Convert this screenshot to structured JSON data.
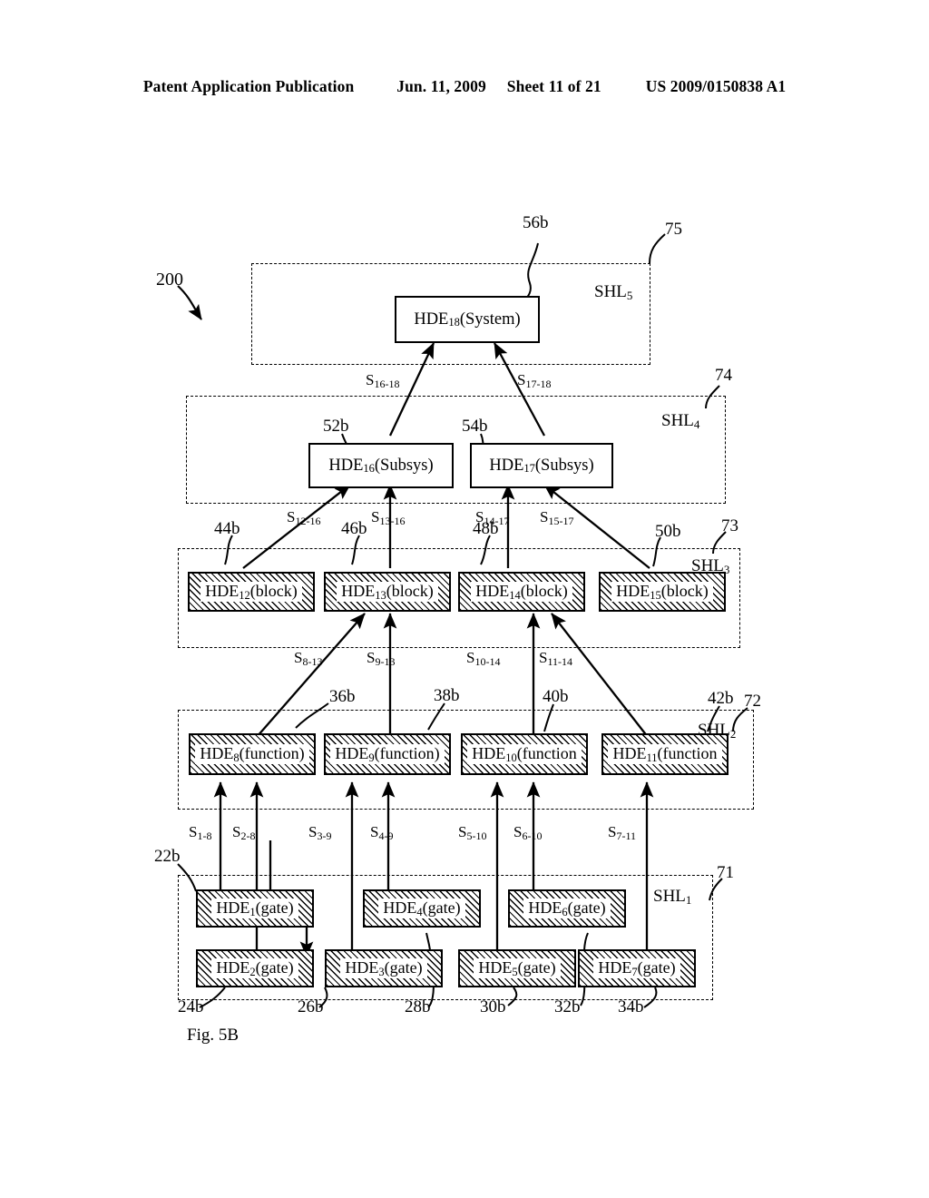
{
  "header": {
    "publication": "Patent Application Publication",
    "date": "Jun. 11, 2009",
    "sheet": "Sheet 11 of 21",
    "patent_number": "US 2009/0150838 A1"
  },
  "figure": {
    "caption": "Fig. 5B",
    "system_ref": "200"
  },
  "layers": [
    {
      "tag": "SHL",
      "sub": "5",
      "ref": "75"
    },
    {
      "tag": "SHL",
      "sub": "4",
      "ref": "74"
    },
    {
      "tag": "SHL",
      "sub": "3",
      "ref": "73"
    },
    {
      "tag": "SHL",
      "sub": "2",
      "ref": "72"
    },
    {
      "tag": "SHL",
      "sub": "1",
      "ref": "71"
    }
  ],
  "elements": {
    "system": [
      {
        "name": "HDE",
        "sub": "18",
        "kind": "(System)",
        "ref": "56b"
      }
    ],
    "subsys": [
      {
        "name": "HDE",
        "sub": "16",
        "kind": "(Subsys)",
        "ref": "52b"
      },
      {
        "name": "HDE",
        "sub": "17",
        "kind": "(Subsys)",
        "ref": "54b"
      }
    ],
    "block": [
      {
        "name": "HDE",
        "sub": "12",
        "kind": "(block)",
        "ref": "44b"
      },
      {
        "name": "HDE",
        "sub": "13",
        "kind": "(block)",
        "ref": "46b"
      },
      {
        "name": "HDE",
        "sub": "14",
        "kind": "(block)",
        "ref": "48b"
      },
      {
        "name": "HDE",
        "sub": "15",
        "kind": "(block)",
        "ref": "50b"
      }
    ],
    "function": [
      {
        "name": "HDE",
        "sub": "8",
        "kind": "(function)",
        "ref": "36b"
      },
      {
        "name": "HDE",
        "sub": "9",
        "kind": "(function)",
        "ref": "38b"
      },
      {
        "name": "HDE",
        "sub": "10",
        "kind": "(function",
        "ref": "40b"
      },
      {
        "name": "HDE",
        "sub": "11",
        "kind": "(function",
        "ref": "42b"
      }
    ],
    "gate": [
      {
        "name": "HDE",
        "sub": "1",
        "kind": "(gate)",
        "ref": "22b"
      },
      {
        "name": "HDE",
        "sub": "2",
        "kind": "(gate)",
        "ref": "24b"
      },
      {
        "name": "HDE",
        "sub": "3",
        "kind": "(gate)",
        "ref": "26b"
      },
      {
        "name": "HDE",
        "sub": "4",
        "kind": "(gate)",
        "ref": "28b"
      },
      {
        "name": "HDE",
        "sub": "5",
        "kind": "(gate)",
        "ref": "30b"
      },
      {
        "name": "HDE",
        "sub": "6",
        "kind": "(gate)",
        "ref": "32b"
      },
      {
        "name": "HDE",
        "sub": "7",
        "kind": "(gate)",
        "ref": "34b"
      }
    ]
  },
  "signals": {
    "to_system": [
      {
        "s": "S",
        "sub": "16-18"
      },
      {
        "s": "S",
        "sub": "17-18"
      }
    ],
    "to_subsys": [
      {
        "s": "S",
        "sub": "12-16"
      },
      {
        "s": "S",
        "sub": "13-16"
      },
      {
        "s": "S",
        "sub": "14-17"
      },
      {
        "s": "S",
        "sub": "15-17"
      }
    ],
    "to_block": [
      {
        "s": "S",
        "sub": "8-13"
      },
      {
        "s": "S",
        "sub": "9-13"
      },
      {
        "s": "S",
        "sub": "10-14"
      },
      {
        "s": "S",
        "sub": "11-14"
      }
    ],
    "to_function": [
      {
        "s": "S",
        "sub": "1-8"
      },
      {
        "s": "S",
        "sub": "2-8"
      },
      {
        "s": "S",
        "sub": "3-9"
      },
      {
        "s": "S",
        "sub": "4-9"
      },
      {
        "s": "S",
        "sub": "5-10"
      },
      {
        "s": "S",
        "sub": "6-10"
      },
      {
        "s": "S",
        "sub": "7-11"
      }
    ]
  }
}
